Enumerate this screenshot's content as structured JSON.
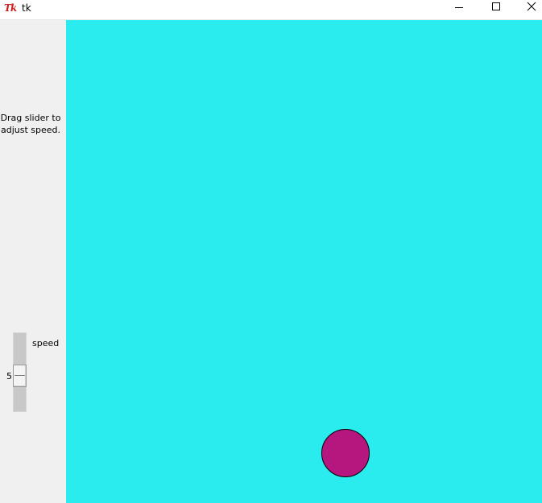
{
  "window": {
    "title": "tk",
    "icon_text": "Tk",
    "icon_color": "#cc1f1f",
    "controls": [
      "minimize-icon",
      "maximize-icon",
      "close-icon"
    ]
  },
  "sidebar": {
    "instructions": "Drag slider to adjust speed.",
    "slider": {
      "label": "speed",
      "value": "5",
      "orientation": "vertical"
    }
  },
  "canvas": {
    "background_color": "#2aebee",
    "ball": {
      "fill_color": "#b5177e",
      "outline_color": "#000000"
    }
  }
}
